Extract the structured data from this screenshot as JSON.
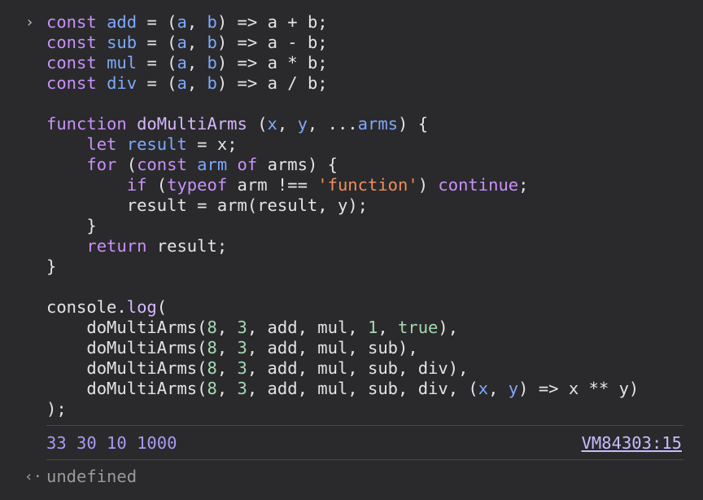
{
  "input": {
    "prompt_glyph": "›",
    "code_lines": [
      "const add = (a, b) => a + b;",
      "const sub = (a, b) => a - b;",
      "const mul = (a, b) => a * b;",
      "const div = (a, b) => a / b;",
      "",
      "function doMultiArms (x, y, ...arms) {",
      "    let result = x;",
      "    for (const arm of arms) {",
      "        if (typeof arm !== 'function') continue;",
      "        result = arm(result, y);",
      "    }",
      "    return result;",
      "}",
      "",
      "console.log(",
      "    doMultiArms(8, 3, add, mul, 1, true),",
      "    doMultiArms(8, 3, add, mul, sub),",
      "    doMultiArms(8, 3, add, mul, sub, div),",
      "    doMultiArms(8, 3, add, mul, sub, div, (x, y) => x ** y)",
      ");"
    ]
  },
  "output": {
    "log_text": "33 30 10 1000",
    "source_link": "VM84303:15"
  },
  "result": {
    "arrow_glyph": "‹·",
    "value": "undefined"
  },
  "colors": {
    "background": "#2a2a2c",
    "keyword": "#c891fb",
    "variable": "#7ea9ff",
    "number": "#a5d9b2",
    "string": "#f08d5b",
    "log_output": "#a99af5"
  }
}
